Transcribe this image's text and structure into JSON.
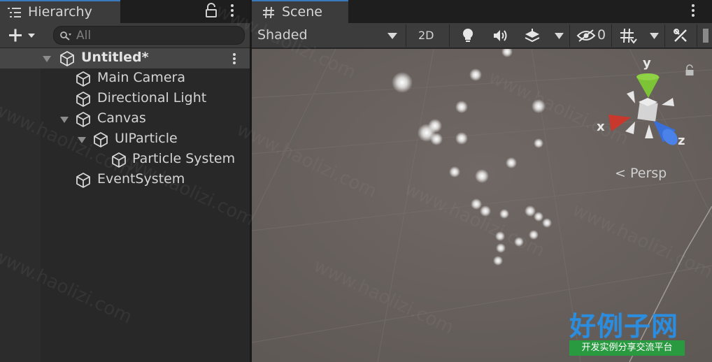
{
  "hierarchy": {
    "tab_label": "Hierarchy",
    "tab_icon": "hierarchy-list-icon",
    "search_placeholder": "All",
    "scene_name": "Untitled*",
    "items": [
      {
        "label": "Main Camera",
        "depth": 0,
        "foldout": "none"
      },
      {
        "label": "Directional Light",
        "depth": 0,
        "foldout": "none"
      },
      {
        "label": "Canvas",
        "depth": 0,
        "foldout": "expanded"
      },
      {
        "label": "UIParticle",
        "depth": 1,
        "foldout": "expanded"
      },
      {
        "label": "Particle System",
        "depth": 2,
        "foldout": "none"
      },
      {
        "label": "EventSystem",
        "depth": 0,
        "foldout": "none"
      }
    ]
  },
  "scene": {
    "tab_label": "Scene",
    "tab_icon": "grid-hash-icon",
    "shading_mode": "Shaded",
    "toggle_2d": "2D",
    "hidden_count": "0",
    "persp_label": "Persp",
    "axes": {
      "x": "x",
      "y": "y",
      "z": "z"
    }
  },
  "watermark": {
    "text": "www.haolizi.com",
    "logo_title": "好例子网",
    "logo_subtitle": "开发实例分享交流平台"
  },
  "colors": {
    "accent_tab": "#3a79bb",
    "axis_x": "#c9382c",
    "axis_y": "#7cc436",
    "axis_z": "#3a6fd8",
    "viewport_bg": "#6b625d",
    "logo_blue": "#2b8de0",
    "logo_green": "#2a9a40"
  }
}
